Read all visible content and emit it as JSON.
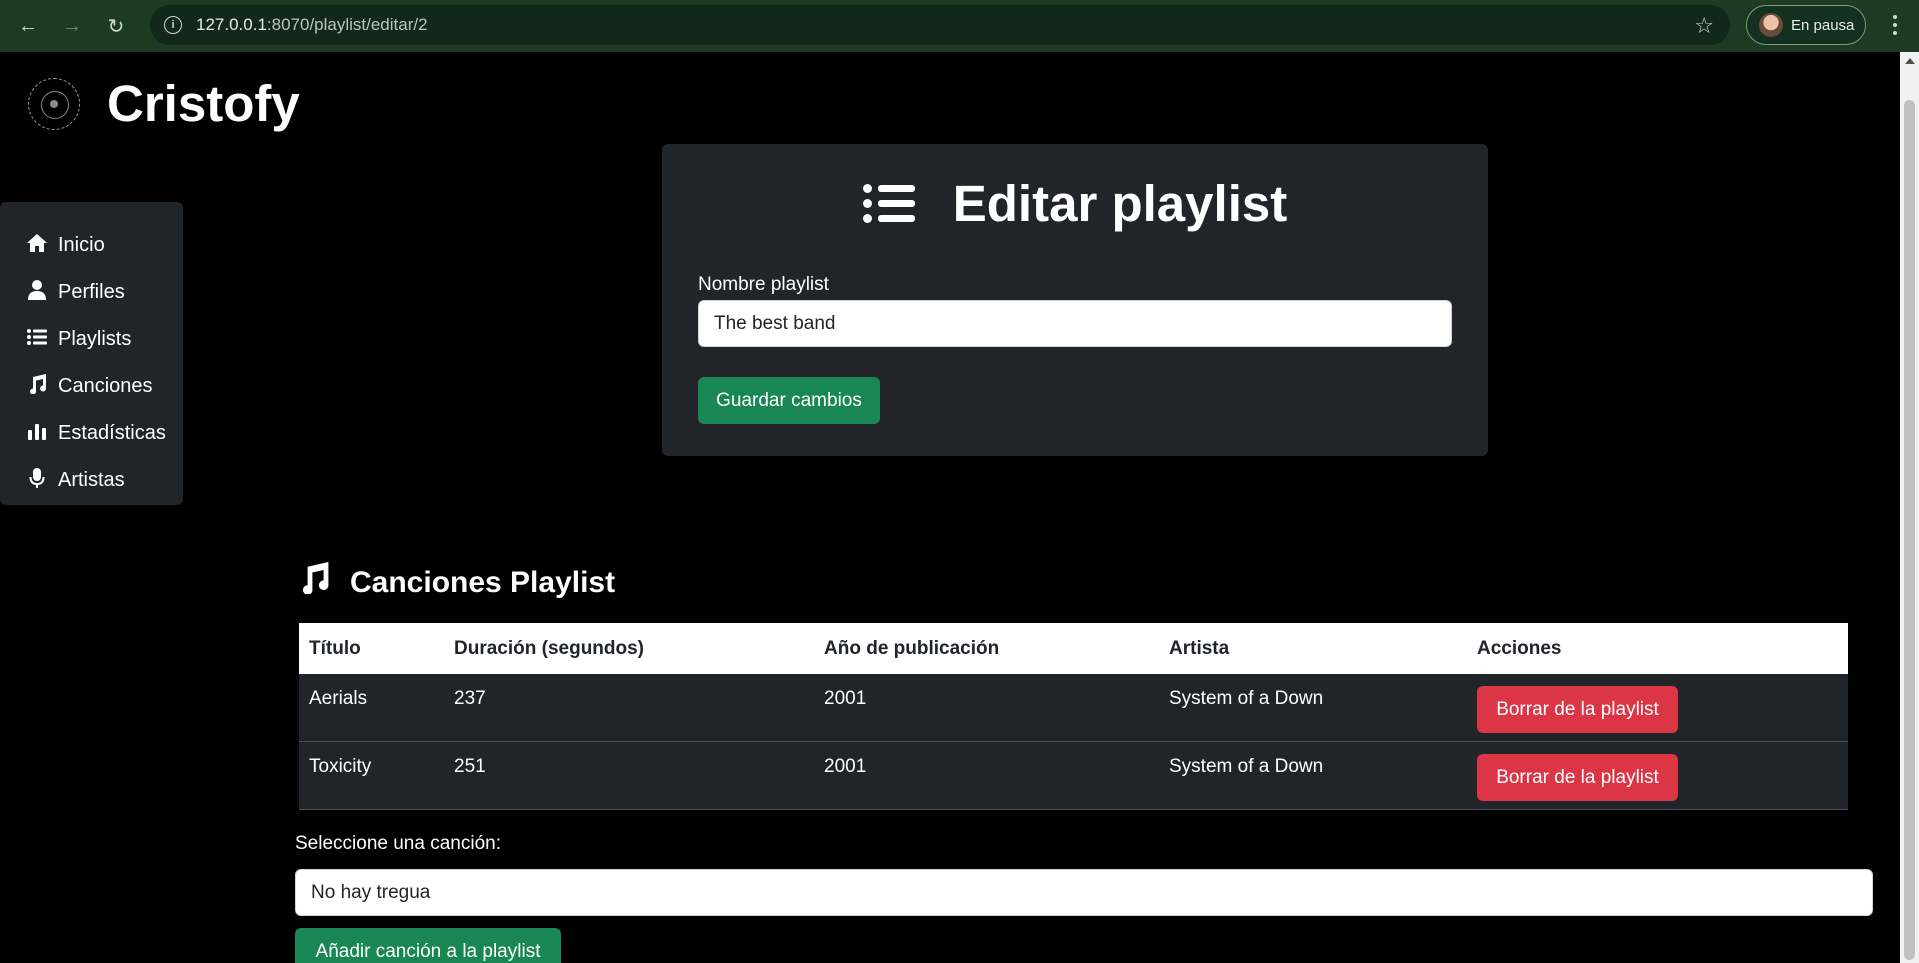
{
  "browser": {
    "url_host": "127.0.0.1",
    "url_path": ":8070/playlist/editar/2",
    "profile_label": "En pausa"
  },
  "brand": {
    "title": "Cristofy"
  },
  "sidebar": {
    "items": [
      {
        "label": "Inicio",
        "icon": "home-icon"
      },
      {
        "label": "Perfiles",
        "icon": "user-icon"
      },
      {
        "label": "Playlists",
        "icon": "list-icon"
      },
      {
        "label": "Canciones",
        "icon": "music-icon"
      },
      {
        "label": "Estadísticas",
        "icon": "chart-icon"
      },
      {
        "label": "Artistas",
        "icon": "microphone-icon"
      }
    ]
  },
  "edit_card": {
    "title": "Editar playlist",
    "name_label": "Nombre playlist",
    "name_value": "The best band",
    "save_label": "Guardar cambios"
  },
  "songs": {
    "title": "Canciones Playlist",
    "columns": [
      "Título",
      "Duración (segundos)",
      "Año de publicación",
      "Artista",
      "Acciones"
    ],
    "rows": [
      {
        "titulo": "Aerials",
        "duracion": "237",
        "anio": "2001",
        "artista": "System of a Down",
        "accion": "Borrar de la playlist"
      },
      {
        "titulo": "Toxicity",
        "duracion": "251",
        "anio": "2001",
        "artista": "System of a Down",
        "accion": "Borrar de la playlist"
      }
    ]
  },
  "add_song": {
    "label": "Seleccione una canción:",
    "selected": "No hay tregua",
    "button_label": "Añadir canción a la playlist"
  },
  "colors": {
    "primary_green": "#198754",
    "danger_red": "#dc3545",
    "card_bg": "#212529",
    "browser_bar": "#1e3a23"
  }
}
